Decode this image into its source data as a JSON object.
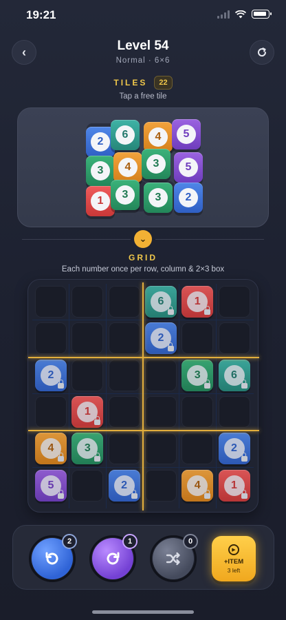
{
  "status": {
    "time": "19:21"
  },
  "header": {
    "title": "Level 54",
    "subtitle": "Normal · 6×6"
  },
  "tiles": {
    "label": "TILES",
    "count": "22",
    "hint": "Tap a free tile"
  },
  "tray_tiles": [
    {
      "n": "2",
      "color": "blue"
    },
    {
      "n": "6",
      "color": "teal"
    },
    {
      "n": "4",
      "color": "orange"
    },
    {
      "n": "5",
      "color": "purple"
    },
    {
      "n": "3",
      "color": "green"
    },
    {
      "n": "4",
      "color": "orange"
    },
    {
      "n": "3",
      "color": "green"
    },
    {
      "n": "5",
      "color": "purple"
    },
    {
      "n": "1",
      "color": "red"
    },
    {
      "n": "3",
      "color": "green"
    },
    {
      "n": "3",
      "color": "green"
    },
    {
      "n": "2",
      "color": "blue"
    }
  ],
  "grid": {
    "label": "GRID",
    "hint": "Each number once per row, column & 2×3 box",
    "rows": [
      [
        null,
        null,
        null,
        {
          "n": "6",
          "color": "teal"
        },
        {
          "n": "1",
          "color": "red"
        },
        null
      ],
      [
        null,
        null,
        null,
        {
          "n": "2",
          "color": "blue"
        },
        null,
        null
      ],
      [
        {
          "n": "2",
          "color": "blue"
        },
        null,
        null,
        null,
        {
          "n": "3",
          "color": "green"
        },
        {
          "n": "6",
          "color": "teal"
        }
      ],
      [
        null,
        {
          "n": "1",
          "color": "red"
        },
        null,
        null,
        null,
        null
      ],
      [
        {
          "n": "4",
          "color": "orange"
        },
        {
          "n": "3",
          "color": "green"
        },
        null,
        null,
        null,
        {
          "n": "2",
          "color": "blue"
        }
      ],
      [
        {
          "n": "5",
          "color": "purple"
        },
        null,
        {
          "n": "2",
          "color": "blue"
        },
        null,
        {
          "n": "4",
          "color": "orange"
        },
        {
          "n": "1",
          "color": "red"
        }
      ]
    ]
  },
  "toolbar": {
    "undo_count": "2",
    "redo_count": "1",
    "shuffle_count": "0",
    "item_label": "+ITEM",
    "item_sub": "3 left"
  },
  "icons": {
    "back": "chevron-left-icon",
    "restart": "restart-icon",
    "toggle": "chevron-down-icon",
    "undo": "undo-icon",
    "redo": "redo-icon",
    "shuffle": "shuffle-icon",
    "item": "play-icon"
  }
}
